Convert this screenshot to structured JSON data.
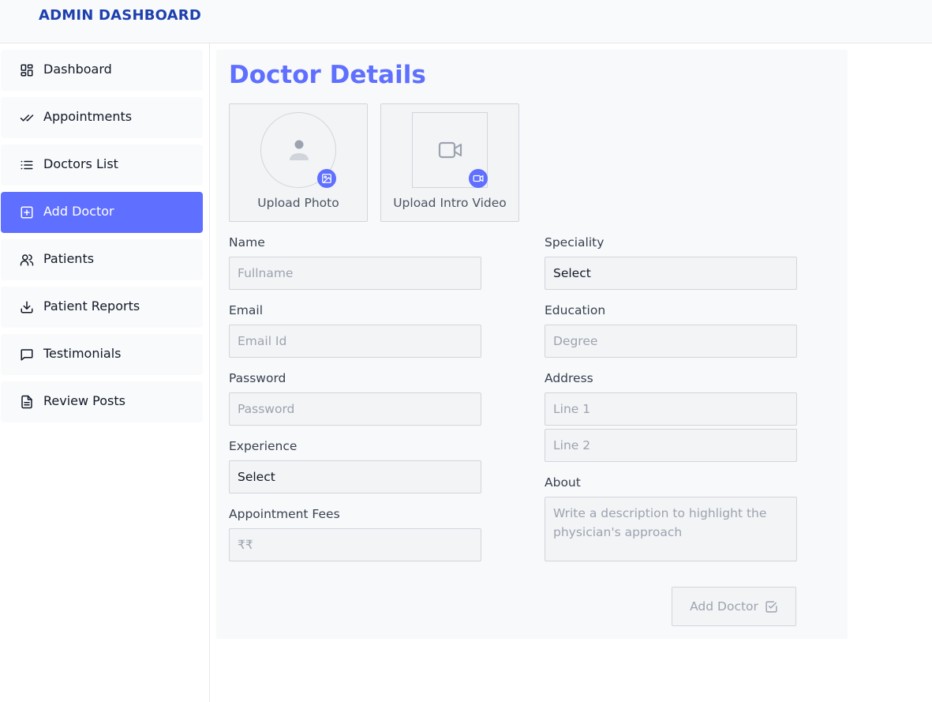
{
  "header": {
    "title": "ADMIN DASHBOARD"
  },
  "sidebar": {
    "items": [
      {
        "label": "Dashboard",
        "icon": "dashboard-icon"
      },
      {
        "label": "Appointments",
        "icon": "double-check-icon"
      },
      {
        "label": "Doctors List",
        "icon": "list-icon"
      },
      {
        "label": "Add Doctor",
        "icon": "plus-square-icon",
        "active": true
      },
      {
        "label": "Patients",
        "icon": "users-icon"
      },
      {
        "label": "Patient Reports",
        "icon": "download-icon"
      },
      {
        "label": "Testimonials",
        "icon": "chat-icon"
      },
      {
        "label": "Review Posts",
        "icon": "document-icon"
      }
    ]
  },
  "main": {
    "title": "Doctor Details",
    "upload_photo": {
      "label": "Upload Photo",
      "icon": "user-avatar-icon",
      "badge_icon": "image-icon"
    },
    "upload_video": {
      "label": "Upload Intro Video",
      "icon": "video-camera-icon",
      "badge_icon": "video-camera-icon"
    },
    "fields": {
      "name": {
        "label": "Name",
        "placeholder": "Fullname"
      },
      "email": {
        "label": "Email",
        "placeholder": "Email Id"
      },
      "password": {
        "label": "Password",
        "placeholder": "Password"
      },
      "experience": {
        "label": "Experience",
        "value": "Select"
      },
      "fees": {
        "label": "Appointment Fees",
        "placeholder": "₹₹"
      },
      "speciality": {
        "label": "Speciality",
        "value": "Select"
      },
      "education": {
        "label": "Education",
        "placeholder": "Degree"
      },
      "address": {
        "label": "Address",
        "line1_placeholder": "Line 1",
        "line2_placeholder": "Line 2"
      },
      "about": {
        "label": "About",
        "placeholder": "Write a description to highlight the physician's approach"
      }
    },
    "submit_label": "Add Doctor"
  },
  "colors": {
    "accent": "#5f6fff",
    "brand": "#1e40af"
  }
}
